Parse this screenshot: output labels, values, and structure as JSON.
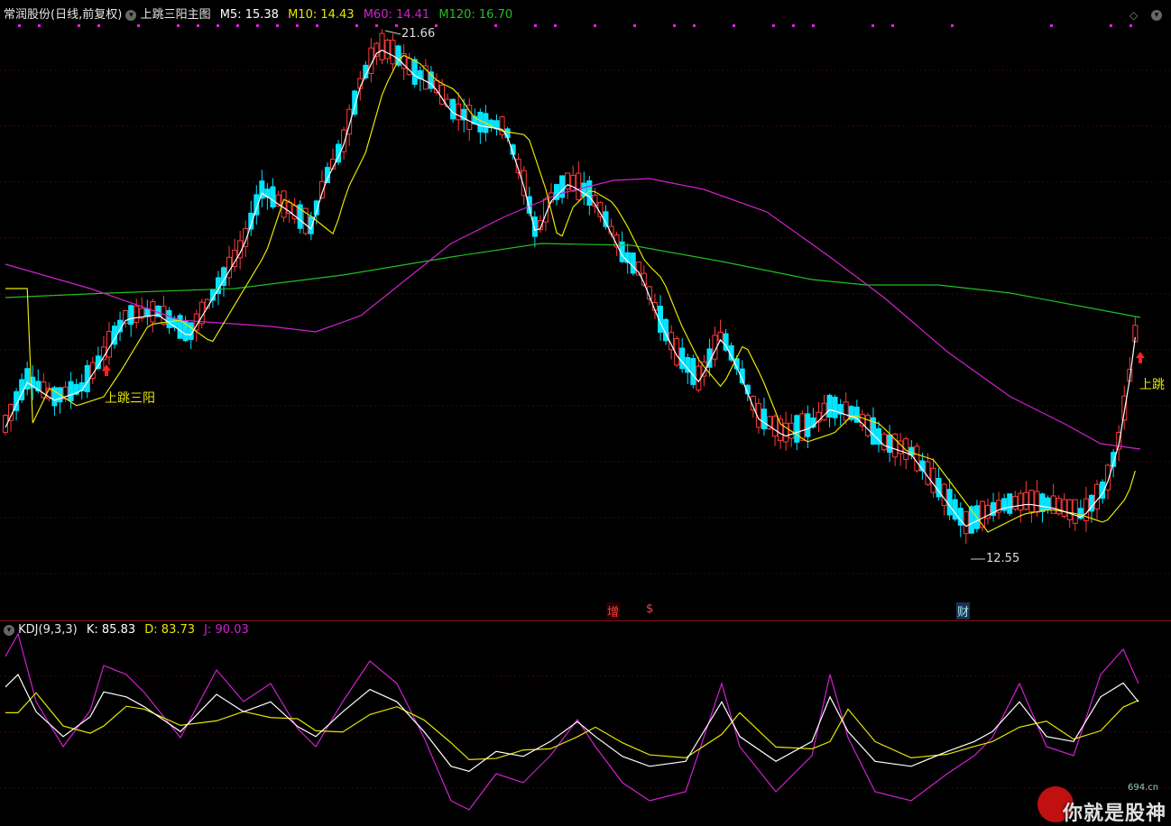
{
  "header": {
    "stock": "常润股份(日线,前复权)",
    "indicator": "上跳三阳主图",
    "ma5": "M5: 15.38",
    "ma10": "M10: 14.43",
    "ma60": "M60: 14.41",
    "ma120": "M120: 16.70"
  },
  "annotations": {
    "high": "21.66",
    "low": "12.55",
    "signal1": "上跳三阳",
    "signal2": "上跳"
  },
  "events": {
    "e1": "增",
    "e2": "$",
    "e3": "财"
  },
  "kdj": {
    "name": "KDJ(9,3,3)",
    "k": "K: 85.83",
    "d": "D: 83.73",
    "j": "J: 90.03"
  },
  "watermark": {
    "text": "你就是股神",
    "site": "694.cn"
  },
  "colors": {
    "up": "#ff3b3b",
    "down": "#00e5ff",
    "ma5": "#ffffff",
    "ma10": "#e6e600",
    "ma60": "#d020d0",
    "ma120": "#20c020",
    "k": "#ffffff",
    "d": "#e6e600",
    "j": "#d020d0"
  }
}
